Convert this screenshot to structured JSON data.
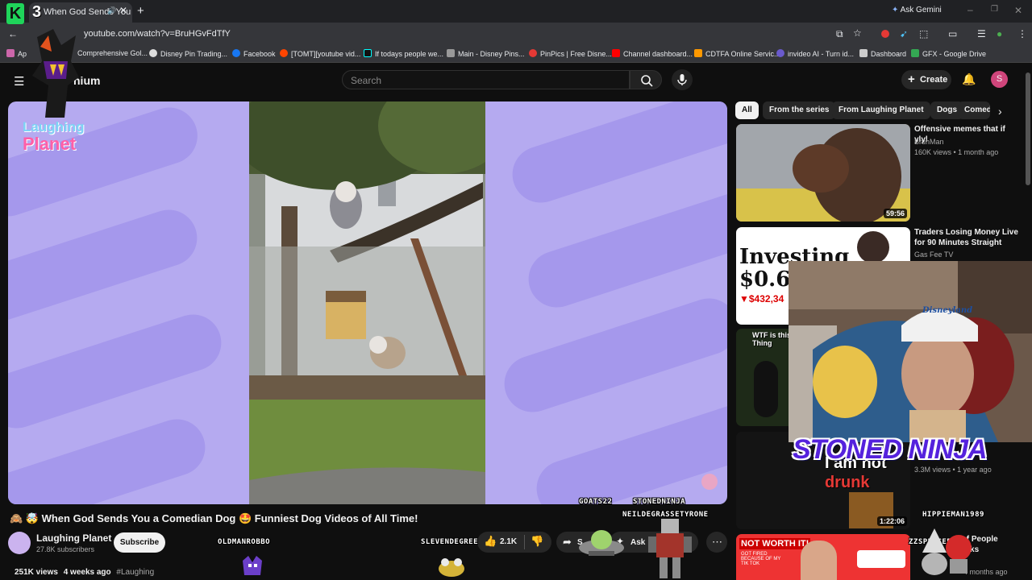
{
  "browser": {
    "tab_title": "When God Sends You",
    "url": "youtube.com/watch?v=BruHGvFdTfY",
    "ask_gemini": "Ask Gemini",
    "bookmarks": [
      "Ap",
      "Comprehensive Gol...",
      "Disney Pin Trading...",
      "Facebook",
      "[TOMT][youtube vid...",
      "If todays people we...",
      "Main - Disney Pins...",
      "PinPics | Free Disne...",
      "Channel dashboard...",
      "CDTFA Online Servic...",
      "invideo AI - Turn id...",
      "Dashboard",
      "GFX - Google Drive"
    ]
  },
  "youtube": {
    "brand_suffix": "nium",
    "search_placeholder": "Search",
    "create_label": "Create",
    "avatar_letter": "S"
  },
  "video": {
    "channel_watermark_line1": "Laughing",
    "channel_watermark_line2": "Planet",
    "title": "🙈 🤯 When God Sends You a Comedian Dog 🤩 Funniest Dog Videos of All Time!",
    "channel_name": "Laughing Planet",
    "subscribers": "27.8K subscribers",
    "subscribe_label": "Subscribe",
    "likes": "2.1K",
    "share_label": "S",
    "ask_label": "Ask",
    "views": "251K views",
    "age": "4 weeks ago",
    "hashtag": "#Laughing"
  },
  "chips": [
    "All",
    "From the series",
    "From Laughing Planet",
    "Dogs",
    "Comed"
  ],
  "recommendations": [
    {
      "title": "Offensive memes that if ylyl",
      "channel": "BruhMan",
      "meta": "160K views • 1 month ago",
      "duration": "59:56"
    },
    {
      "title": "Traders Losing Money Live for 90 Minutes Straight",
      "channel": "Gas Fee TV",
      "meta": "",
      "duration": ""
    },
    {
      "title": "",
      "channel": "",
      "meta": "",
      "duration": ""
    },
    {
      "title": "",
      "channel": "",
      "meta": "3.3M views • 1 year ago",
      "duration": "1:22:06"
    },
    {
      "title": "r of People kToks",
      "channel": "",
      "meta": "4 months ago",
      "duration": ""
    }
  ],
  "thumb_text": {
    "investing": "Investing",
    "price": "$0.61",
    "price_change": "▼$432,34",
    "wtf": "WTF is this Thing",
    "iamnot": "I am not",
    "drunk": "drunk",
    "not_worth": "NOT WORTH IT!",
    "fired": "GOT FIRED BECAUSE OF MY TIK TOK"
  },
  "overlay": {
    "stream_logo": "K3",
    "webcam_title": "STONED NINJA",
    "cap_text": "Disneyland",
    "chat_names": [
      "GOATS22",
      "STONEDNINJA",
      "NEILDEGRASSETYRONE",
      "OLDMANROBBO",
      "SLEVENDEGREE",
      "HIPPIEMAN1989",
      "ZZSPENCER"
    ]
  }
}
